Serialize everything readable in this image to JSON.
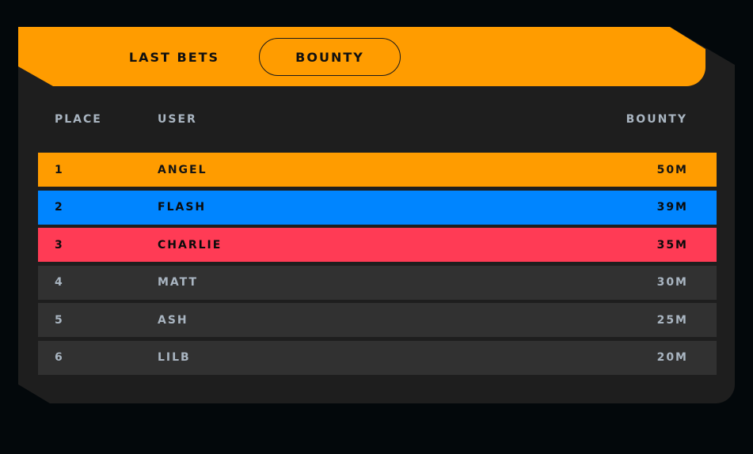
{
  "tabs": [
    {
      "label": "LAST BETS",
      "active": false
    },
    {
      "label": "BOUNTY",
      "active": true
    }
  ],
  "table": {
    "headers": {
      "place": "PLACE",
      "user": "USER",
      "bounty": "BOUNTY"
    },
    "rows": [
      {
        "place": "1",
        "user": "ANGEL",
        "bounty": "50M",
        "bg": "#ff9c00",
        "fg": "#141414"
      },
      {
        "place": "2",
        "user": "FLASH",
        "bounty": "39M",
        "bg": "#0085ff",
        "fg": "#0b0b0b"
      },
      {
        "place": "3",
        "user": "CHARLIE",
        "bounty": "35M",
        "bg": "#ff3b55",
        "fg": "#0b0b0b"
      },
      {
        "place": "4",
        "user": "MATT",
        "bounty": "30M",
        "bg": "#313131",
        "fg": "#a9b5c1"
      },
      {
        "place": "5",
        "user": "ASH",
        "bounty": "25M",
        "bg": "#313131",
        "fg": "#a9b5c1"
      },
      {
        "place": "6",
        "user": "LILB",
        "bounty": "20M",
        "bg": "#313131",
        "fg": "#a9b5c1"
      }
    ]
  },
  "colors": {
    "background": "#03080b",
    "panel": "#1e1e1e",
    "header": "#ff9c00",
    "header_text": "#a9b5c1"
  }
}
